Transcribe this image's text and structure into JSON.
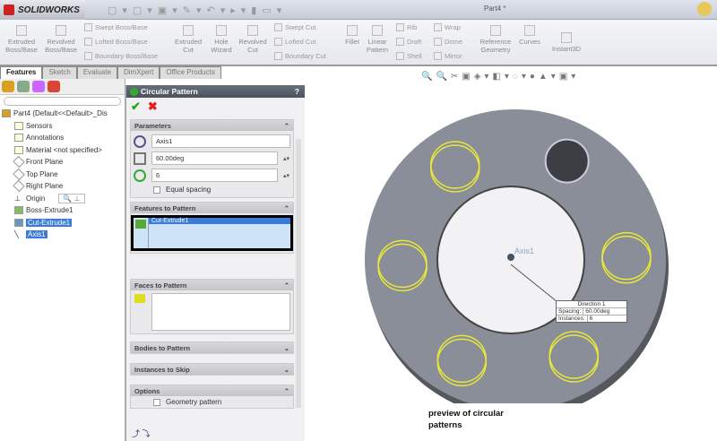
{
  "app": {
    "logo": "SOLIDWORKS",
    "window_title": "Part4 *"
  },
  "ribbon": {
    "big": [
      "Extruded Boss/Base",
      "Revolved Boss/Base",
      "Extruded Cut",
      "Hole Wizard",
      "Revolved Cut",
      "Fillet",
      "Linear Pattern",
      "Reference Geometry",
      "Curves",
      "Instant3D"
    ],
    "small": [
      "Swept Boss/Base",
      "Lofted Boss/Base",
      "Boundary Boss/Base",
      "Swept Cut",
      "Lofted Cut",
      "Boundary Cut",
      "Rib",
      "Draft",
      "Shell",
      "Wrap",
      "Dome",
      "Mirror"
    ]
  },
  "tabs": [
    "Features",
    "Sketch",
    "Evaluate",
    "DimXpert",
    "Office Products"
  ],
  "tree": {
    "root": "Part4  (Default<<Default>_Dis",
    "items": [
      "Sensors",
      "Annotations",
      "Material <not specified>",
      "Front Plane",
      "Top Plane",
      "Right Plane",
      "Origin",
      "Boss-Extrude1",
      "Cut-Extrude1",
      "Axis1"
    ]
  },
  "pm": {
    "title": "Circular Pattern",
    "help": "?",
    "parameters": {
      "header": "Parameters",
      "axis": "Axis1",
      "angle": "60.00deg",
      "instances": "6",
      "equal_spacing_label": "Equal spacing",
      "equal_spacing": false
    },
    "features": {
      "header": "Features to Pattern",
      "items": [
        "Cut-Extrude1"
      ]
    },
    "faces": {
      "header": "Faces to Pattern"
    },
    "bodies": {
      "header": "Bodies to Pattern"
    },
    "skip": {
      "header": "Instances to Skip"
    },
    "options": {
      "header": "Options",
      "geometry_pattern_label": "Geometry pattern",
      "geometry_pattern": false
    }
  },
  "viewport": {
    "axis_label": "Axis1",
    "callout": {
      "title": "Direction 1",
      "spacing_label": "Spacing:",
      "spacing": "60.00deg",
      "instances_label": "Instances:",
      "instances": "6"
    },
    "note": "preview of circular patterns",
    "colors": {
      "part": "#8a8e99",
      "preview": "#e8e83a"
    }
  }
}
